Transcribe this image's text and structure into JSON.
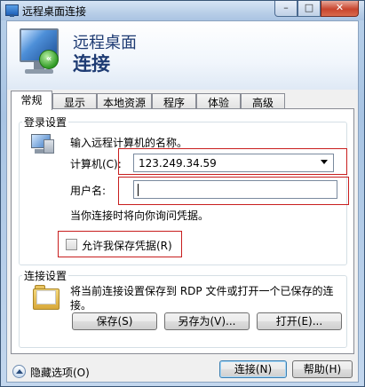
{
  "window": {
    "title": "远程桌面连接",
    "min_glyph": "–",
    "max_glyph": "□",
    "close_glyph": "✕"
  },
  "banner": {
    "line1": "远程桌面",
    "line2": "连接",
    "badge_glyph": "«"
  },
  "tabs": [
    {
      "label": "常规",
      "active": true
    },
    {
      "label": "显示"
    },
    {
      "label": "本地资源"
    },
    {
      "label": "程序"
    },
    {
      "label": "体验"
    },
    {
      "label": "高级"
    }
  ],
  "logon": {
    "group_label": "登录设置",
    "prompt": "输入远程计算机的名称。",
    "computer_label": "计算机(C):",
    "computer_value": "123.249.34.59",
    "username_label": "用户名:",
    "username_value": "",
    "note": "当你连接时将向你询问凭据。",
    "save_credentials_label": "允许我保存凭据(R)",
    "save_credentials_checked": false
  },
  "connection": {
    "group_label": "连接设置",
    "description_line1": "将当前连接设置保存到 RDP 文件或打开一个已保存的连",
    "description_line2": "接。",
    "save_label": "保存(S)",
    "save_as_label": "另存为(V)...",
    "open_label": "打开(E)..."
  },
  "footer": {
    "options_label": "隐藏选项(O)",
    "connect_label": "连接(N)",
    "help_label": "帮助(H)"
  },
  "icons": {
    "app": "remote-desktop-icon",
    "computer": "computer-icon",
    "folder": "folder-icon",
    "options": "chevron-up-circle-icon"
  },
  "colors": {
    "highlight_box": "#c81e1e",
    "banner_text": "#1e3b73"
  }
}
